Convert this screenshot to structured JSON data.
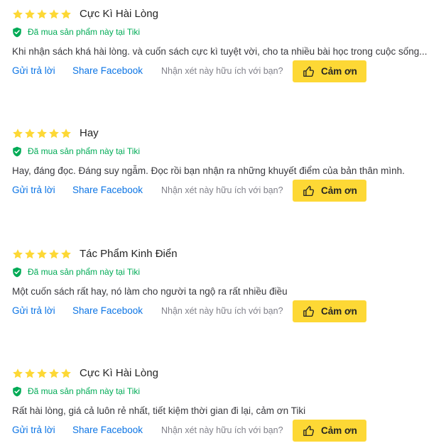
{
  "reviews": [
    {
      "rating": 5,
      "title": "Cực Kì Hài Lòng",
      "verified_text": "Đã mua sản phẩm này tại Tiki",
      "content": "Khi nhận sách khá hài lòng. và cuốn sách cực kì tuyệt vời, cho ta nhiều bài học trong cuộc sống...",
      "reply_label": "Gửi trả lời",
      "share_label": "Share Facebook",
      "helpful_question": "Nhận xét này hữu ích với bạn?",
      "thanks_label": "Cảm ơn"
    },
    {
      "rating": 5,
      "title": "Hay",
      "verified_text": "Đã mua sản phẩm này tại Tiki",
      "content": "Hay, đáng đọc. Đáng suy ngẫm. Đọc rồi bạn nhận ra những khuyết điểm của bản thân mình.",
      "reply_label": "Gửi trả lời",
      "share_label": "Share Facebook",
      "helpful_question": "Nhận xét này hữu ích với bạn?",
      "thanks_label": "Cảm ơn"
    },
    {
      "rating": 5,
      "title": "Tác Phẩm Kinh Điển",
      "verified_text": "Đã mua sản phẩm này tại Tiki",
      "content": "Một cuốn sách rất hay, nó làm cho người ta ngộ ra rất nhiều điều",
      "reply_label": "Gửi trả lời",
      "share_label": "Share Facebook",
      "helpful_question": "Nhận xét này hữu ích với bạn?",
      "thanks_label": "Cảm ơn"
    },
    {
      "rating": 5,
      "title": "Cực Kì Hài Lòng",
      "verified_text": "Đã mua sản phẩm này tại Tiki",
      "content": "Rất hài lòng, giá cả luôn rẻ nhất, tiết kiệm thời gian đi lại, cảm ơn Tiki",
      "reply_label": "Gửi trả lời",
      "share_label": "Share Facebook",
      "helpful_question": "Nhận xét này hữu ích với bạn?",
      "thanks_label": "Cảm ơn"
    }
  ],
  "colors": {
    "star": "#fdd835",
    "verified": "#00ab56",
    "link": "#0b74e5",
    "thanks_button": "#fdd835"
  },
  "icons": {
    "rating": "star-icon",
    "verified": "shield-check-icon",
    "thanks": "thumbs-up-icon"
  }
}
